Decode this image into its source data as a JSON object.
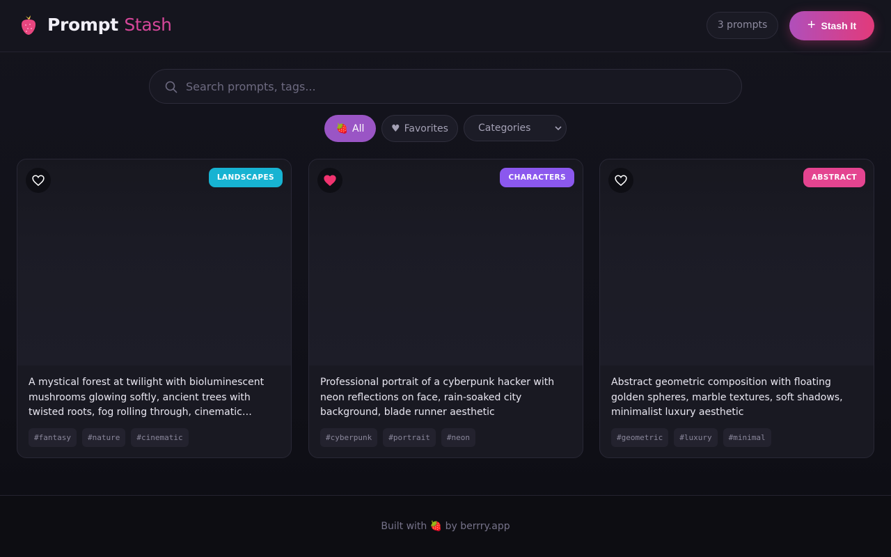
{
  "header": {
    "brand_word1": "Prompt",
    "brand_word2": "Stash",
    "logo_icon": "strawberry-icon",
    "count_label": "3 prompts",
    "stash_button_label": "Stash It"
  },
  "search": {
    "placeholder": "Search prompts, tags...",
    "value": ""
  },
  "filters": {
    "all_icon": "🍓",
    "all_label": "All",
    "favorites_icon": "♥",
    "favorites_label": "Favorites",
    "categories_label": "Categories"
  },
  "cards": [
    {
      "category": "LANDSCAPES",
      "badge_color": "#17b3d2",
      "favorited": false,
      "description": "A mystical forest at twilight with bioluminescent mushrooms glowing softly, ancient trees with twisted roots, fog rolling through, cinematic lighting",
      "tags": [
        "#fantasy",
        "#nature",
        "#cinematic"
      ]
    },
    {
      "category": "CHARACTERS",
      "badge_color": "#8b58ee",
      "favorited": true,
      "description": "Professional portrait of a cyberpunk hacker with neon reflections on face, rain-soaked city background, blade runner aesthetic",
      "tags": [
        "#cyberpunk",
        "#portrait",
        "#neon"
      ]
    },
    {
      "category": "ABSTRACT",
      "badge_color": "#e44490",
      "favorited": false,
      "description": "Abstract geometric composition with floating golden spheres, marble textures, soft shadows, minimalist luxury aesthetic",
      "tags": [
        "#geometric",
        "#luxury",
        "#minimal"
      ]
    }
  ],
  "footer": {
    "prefix": "Built with",
    "emoji": "🍓",
    "suffix": "by berrry.app"
  },
  "colors": {
    "accent": "#d6479a",
    "button_gradient_start": "#b04fbb",
    "button_gradient_end": "#e23a7a",
    "favorite_heart": "#f0336f"
  }
}
